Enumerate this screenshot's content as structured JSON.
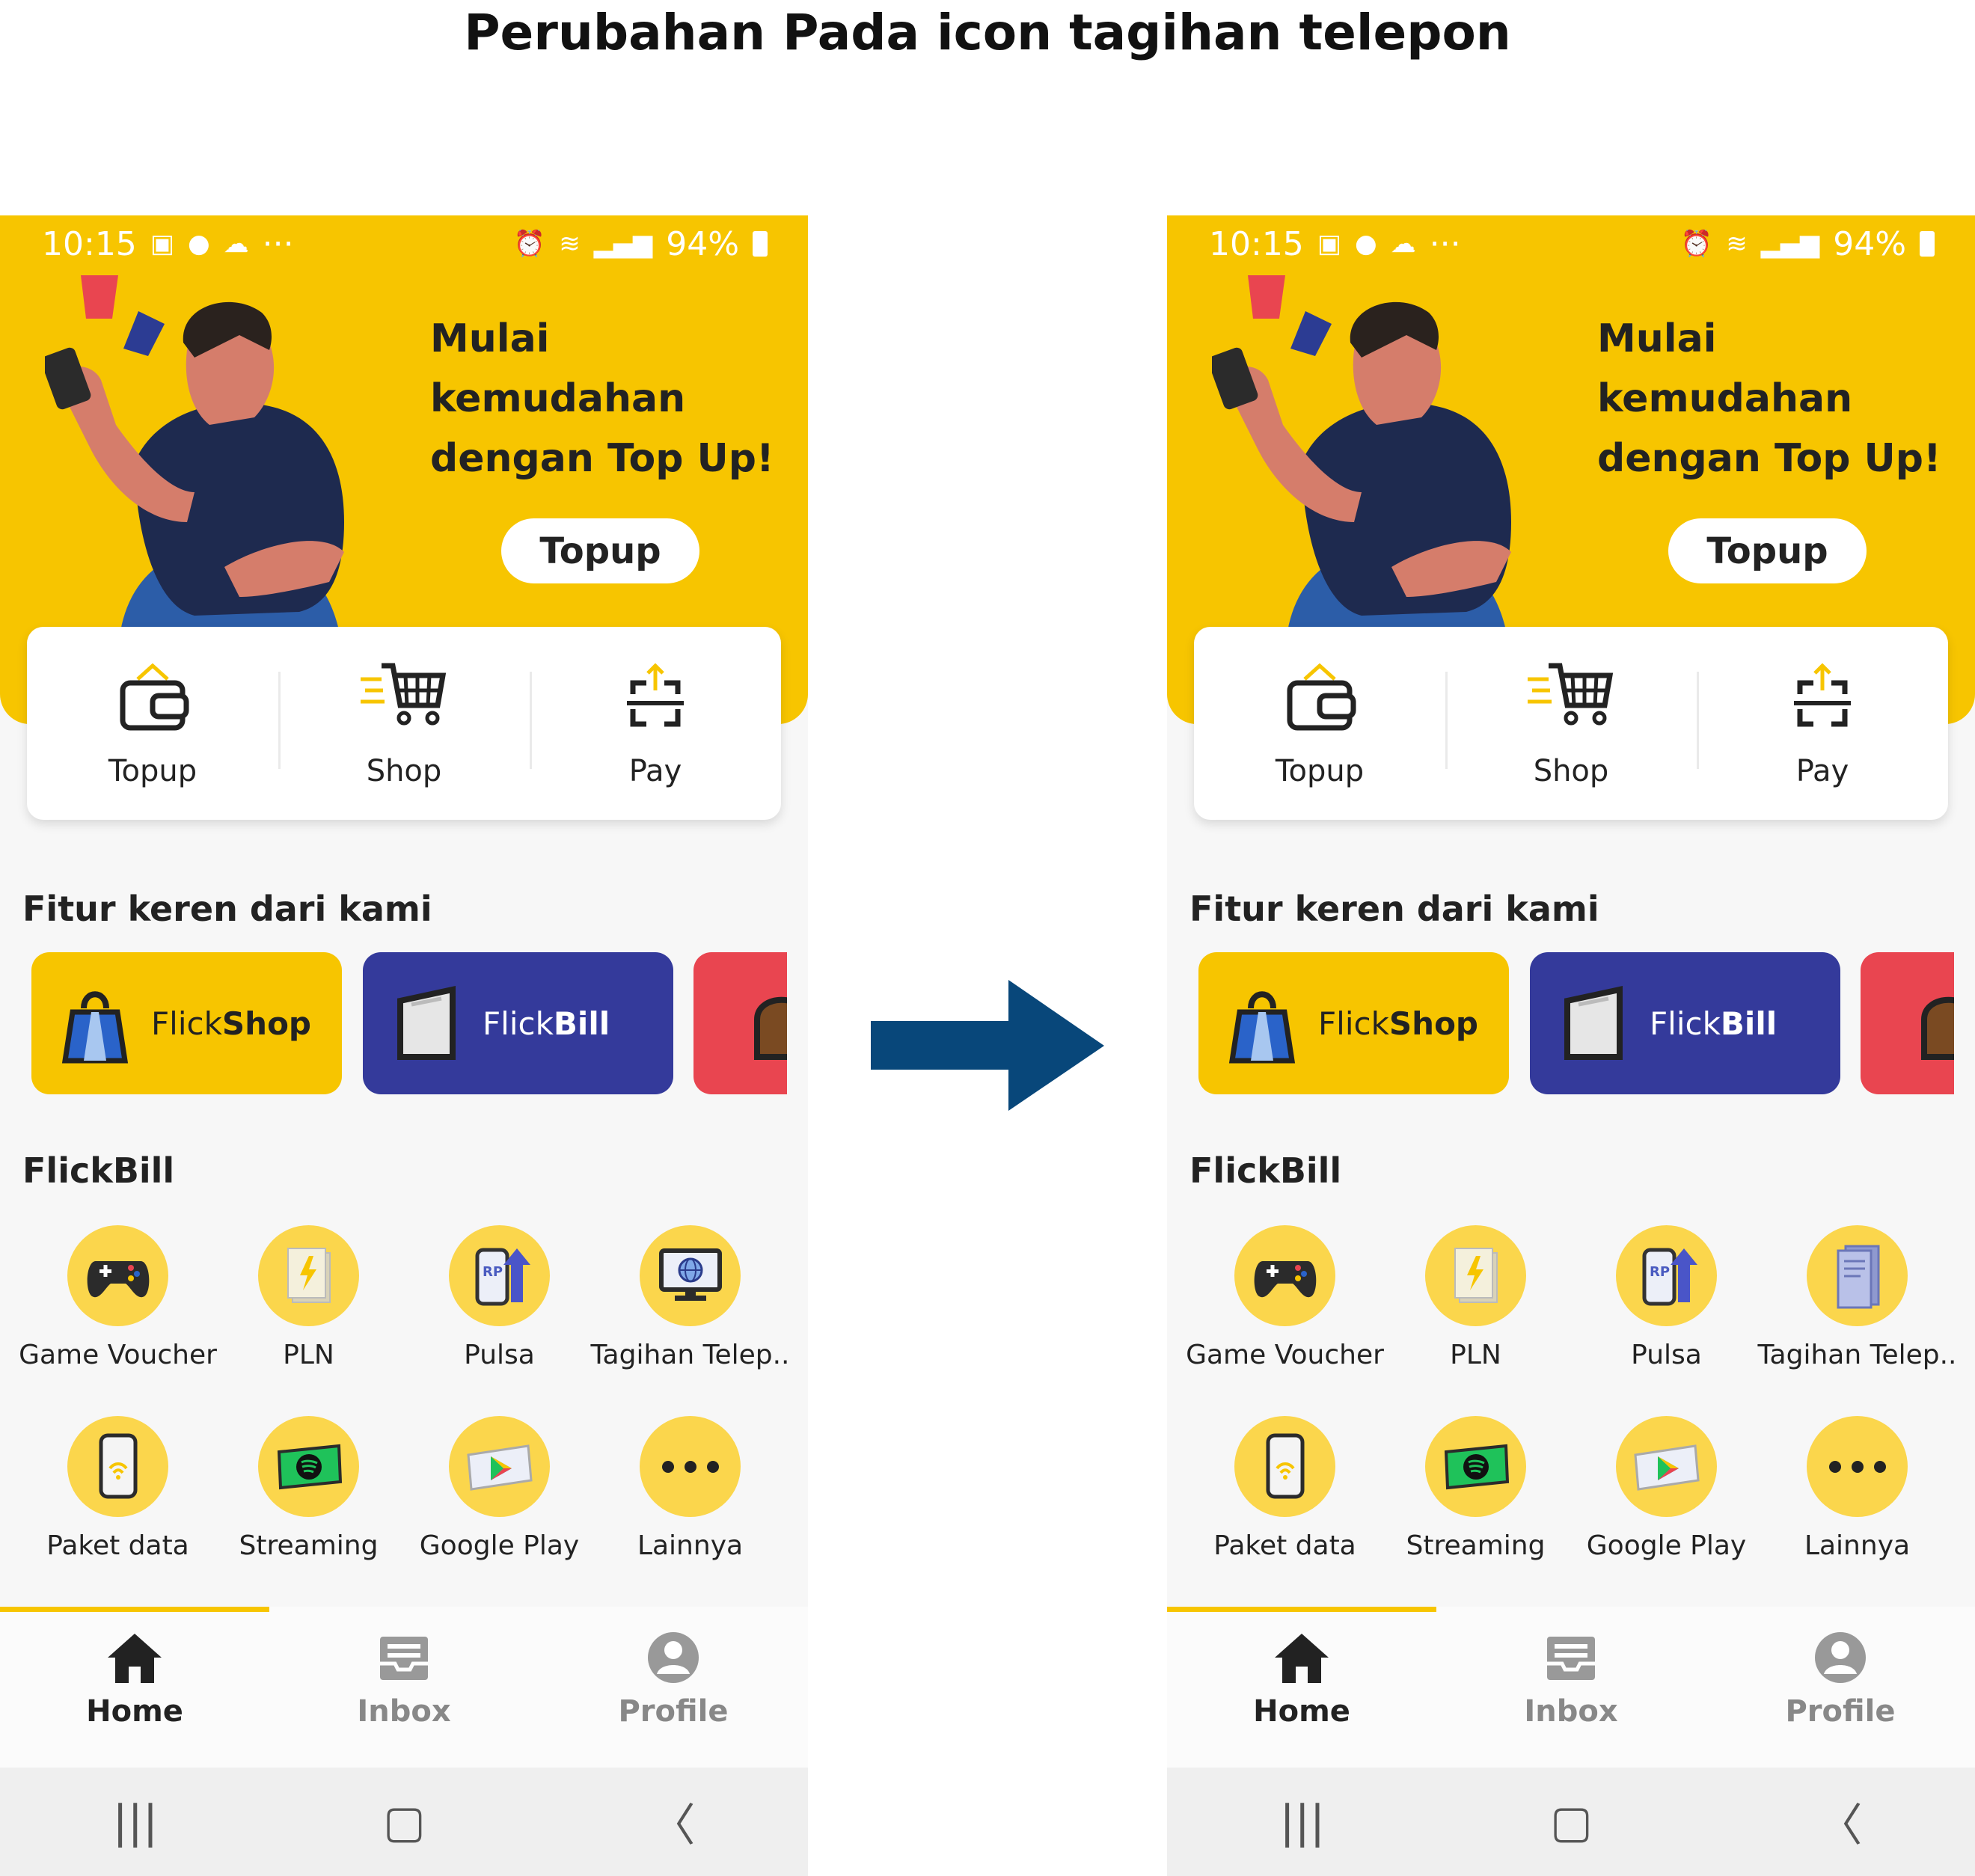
{
  "title": "Perubahan Pada icon tagihan telepon",
  "status_bar": {
    "time": "10:15",
    "dots": "···",
    "battery": "94%"
  },
  "banner": {
    "headline_lines": [
      "Mulai",
      "kemudahan",
      "dengan Top Up!"
    ],
    "button": "Topup"
  },
  "quick_actions": [
    {
      "label": "Topup",
      "icon": "wallet-icon"
    },
    {
      "label": "Shop",
      "icon": "cart-icon"
    },
    {
      "label": "Pay",
      "icon": "scan-upload-icon"
    }
  ],
  "features_section": {
    "title": "Fitur keren dari kami",
    "cards": [
      {
        "label_regular": "Flick",
        "label_bold": "Shop",
        "color": "#f7c500",
        "icon": "shopping-bag-icon"
      },
      {
        "label_regular": "Flick",
        "label_bold": "Bill",
        "color": "#343a9b",
        "icon": "bill-card-icon"
      },
      {
        "label_regular": "",
        "label_bold": "",
        "color": "#e94550",
        "icon": "partial-feature-icon"
      }
    ]
  },
  "flickbill": {
    "title": "FlickBill",
    "items": [
      "Game Voucher",
      "PLN",
      "Pulsa",
      "Tagihan Telep..",
      "Paket data",
      "Streaming",
      "Google Play",
      "Lainnya"
    ],
    "icons": [
      "gamepad-icon",
      "electricity-bill-icon",
      "phone-credit-icon",
      "phone-bill-icon",
      "mobile-data-icon",
      "spotify-ticket-icon",
      "google-play-icon",
      "more-icon"
    ],
    "tagihan_icon_before": "computer-globe-icon",
    "tagihan_icon_after": "document-bill-icon"
  },
  "bottom_nav": [
    {
      "label": "Home",
      "icon": "home-icon",
      "active": true
    },
    {
      "label": "Inbox",
      "icon": "inbox-icon",
      "active": false
    },
    {
      "label": "Profile",
      "icon": "profile-icon",
      "active": false
    }
  ],
  "colors": {
    "brand_yellow": "#f7c500",
    "flickbill_blue": "#343a9b",
    "arrow": "#08477a",
    "accent_red": "#e94550"
  }
}
